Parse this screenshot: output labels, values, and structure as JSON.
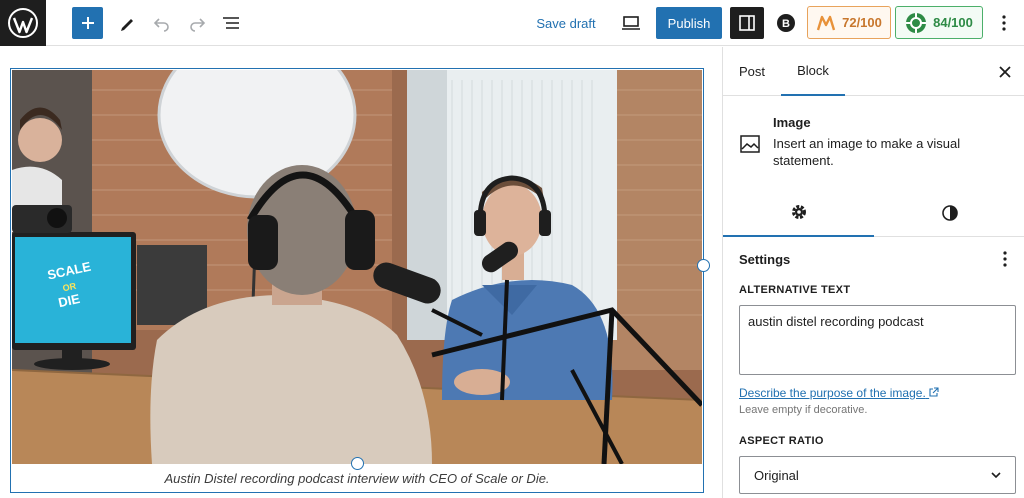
{
  "toolbar": {
    "save_draft": "Save draft",
    "publish": "Publish",
    "score_1": "72/100",
    "score_2": "84/100",
    "colors": {
      "accent": "#2271b1",
      "score_1": "#c8772d",
      "score_2": "#2e8b46"
    }
  },
  "canvas": {
    "caption": "Austin Distel recording podcast interview with CEO of Scale or Die.",
    "monitor_text_1": "SCALE",
    "monitor_text_2": "OR",
    "monitor_text_3": "DIE"
  },
  "sidebar": {
    "tabs": {
      "post": "Post",
      "block": "Block"
    },
    "block": {
      "title": "Image",
      "description": "Insert an image to make a visual statement."
    },
    "settings": {
      "heading": "Settings",
      "alt_label": "ALTERNATIVE TEXT",
      "alt_value": "austin distel recording podcast",
      "describe_link": "Describe the purpose of the image.",
      "help": "Leave empty if decorative.",
      "aspect_label": "ASPECT RATIO",
      "aspect_value": "Original"
    }
  }
}
